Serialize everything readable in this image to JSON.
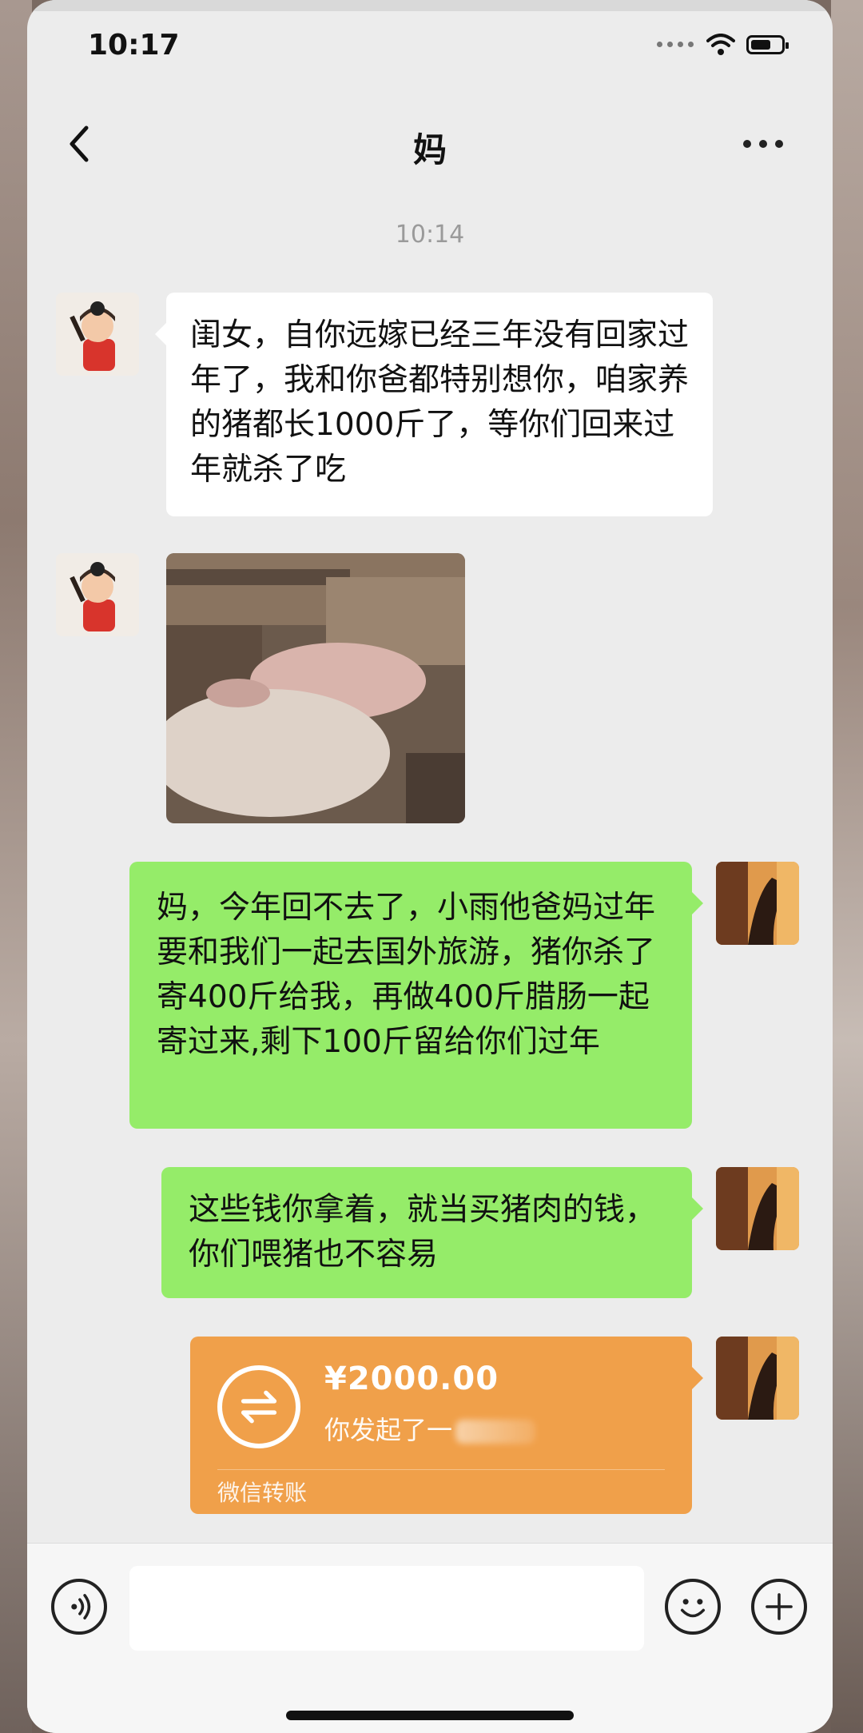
{
  "status_bar": {
    "time": "10:17"
  },
  "nav": {
    "title": "妈",
    "back_icon": "chevron-left-icon",
    "more_icon": "more-dots-icon"
  },
  "chat": {
    "timestamp": "10:14",
    "messages": [
      {
        "side": "left",
        "text": "闺女，自你远嫁已经三年没有回家过年了，我和你爸都特别想你，咱家养的猪都长1000斤了，等你们回来过年就杀了吃"
      },
      {
        "side": "left",
        "type": "image",
        "alt": "猪"
      },
      {
        "side": "right",
        "text": "妈，今年回不去了，小雨他爸妈过年要和我们一起去国外旅游，猪你杀了寄400斤给我，再做400斤腊肠一起寄过来,剩下100斤留给你们过年"
      },
      {
        "side": "right",
        "text": "这些钱你拿着，就当买猪肉的钱，你们喂猪也不容易"
      }
    ],
    "transfer": {
      "amount": "¥2000.00",
      "description": "你发起了一",
      "footer": "微信转账",
      "color": "#f0a04a"
    }
  },
  "input_bar": {
    "voice_icon": "voice-icon",
    "emoji_icon": "emoji-icon",
    "plus_icon": "plus-icon"
  },
  "colors": {
    "bubble_self": "#95ec69",
    "bubble_other": "#ffffff",
    "background": "#ececec"
  }
}
